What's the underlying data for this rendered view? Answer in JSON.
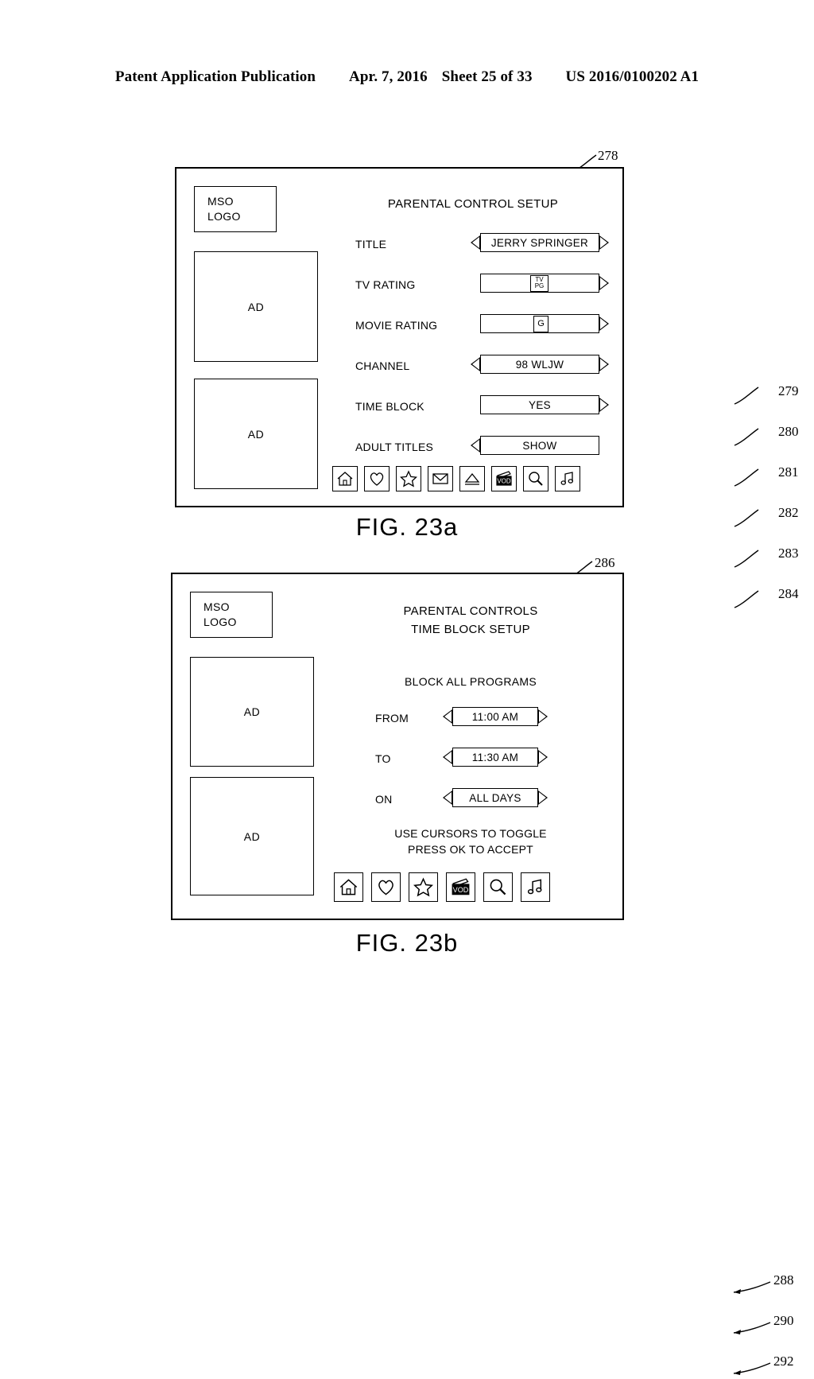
{
  "publication_header": {
    "left": "Patent Application Publication",
    "date": "Apr. 7, 2016",
    "sheet": "Sheet 25 of 33",
    "number": "US 2016/0100202 A1"
  },
  "figures": [
    {
      "caption": "FIG. 23a",
      "screen_ref": "278",
      "logo": {
        "line1": "MSO",
        "line2": "LOGO"
      },
      "ads": [
        "AD",
        "AD"
      ],
      "title": "PARENTAL CONTROL SETUP",
      "rows": [
        {
          "label": "TITLE",
          "value": "JERRY SPRINGER",
          "ref": "279",
          "left_arrow": true,
          "right_arrow": true,
          "style": "text"
        },
        {
          "label": "TV RATING",
          "value": "TV PG",
          "ref": "280",
          "left_arrow": false,
          "right_arrow": true,
          "style": "chip-tv",
          "chip_top": "TV",
          "chip_bottom": "PG"
        },
        {
          "label": "MOVIE RATING",
          "value": "G",
          "ref": "281",
          "left_arrow": false,
          "right_arrow": true,
          "style": "chip-movie",
          "chip_top": "G"
        },
        {
          "label": "CHANNEL",
          "value": "98 WLJW",
          "ref": "282",
          "left_arrow": true,
          "right_arrow": true,
          "style": "text"
        },
        {
          "label": "TIME BLOCK",
          "value": "YES",
          "ref": "283",
          "left_arrow": false,
          "right_arrow": true,
          "style": "text"
        },
        {
          "label": "ADULT TITLES",
          "value": "SHOW",
          "ref": "284",
          "left_arrow": true,
          "right_arrow": false,
          "style": "text"
        }
      ],
      "icons": [
        {
          "name": "home-icon",
          "label": "HOME"
        },
        {
          "name": "heart-icon",
          "label": "FAVORITES"
        },
        {
          "name": "star-icon",
          "label": "FEATURED"
        },
        {
          "name": "envelope-icon",
          "label": "MAIL"
        },
        {
          "name": "pyramid-icon",
          "label": "GUIDE"
        },
        {
          "name": "vod-icon",
          "label": "VOD"
        },
        {
          "name": "magnifier-icon",
          "label": "SEARCH"
        },
        {
          "name": "music-icon",
          "label": "MUSIC"
        }
      ]
    },
    {
      "caption": "FIG. 23b",
      "screen_ref": "286",
      "logo": {
        "line1": "MSO",
        "line2": "LOGO"
      },
      "ads": [
        "AD",
        "AD"
      ],
      "title": "PARENTAL CONTROLS\nTIME BLOCK SETUP",
      "section_label": "BLOCK ALL PROGRAMS",
      "rows": [
        {
          "label": "FROM",
          "value": "11:00 AM",
          "ref": "288",
          "left_arrow": true,
          "right_arrow": true
        },
        {
          "label": "TO",
          "value": "11:30 AM",
          "ref": "290",
          "left_arrow": true,
          "right_arrow": true
        },
        {
          "label": "ON",
          "value": "ALL DAYS",
          "ref": "292",
          "left_arrow": true,
          "right_arrow": true
        }
      ],
      "help_text": "USE CURSORS TO TOGGLE\nPRESS OK TO ACCEPT",
      "icons": [
        {
          "name": "home-icon",
          "label": "HOME"
        },
        {
          "name": "heart-icon",
          "label": "FAVORITES"
        },
        {
          "name": "star-icon",
          "label": "FEATURED"
        },
        {
          "name": "vod-icon",
          "label": "VOD"
        },
        {
          "name": "magnifier-icon",
          "label": "SEARCH"
        },
        {
          "name": "music-icon",
          "label": "MUSIC"
        }
      ]
    }
  ]
}
